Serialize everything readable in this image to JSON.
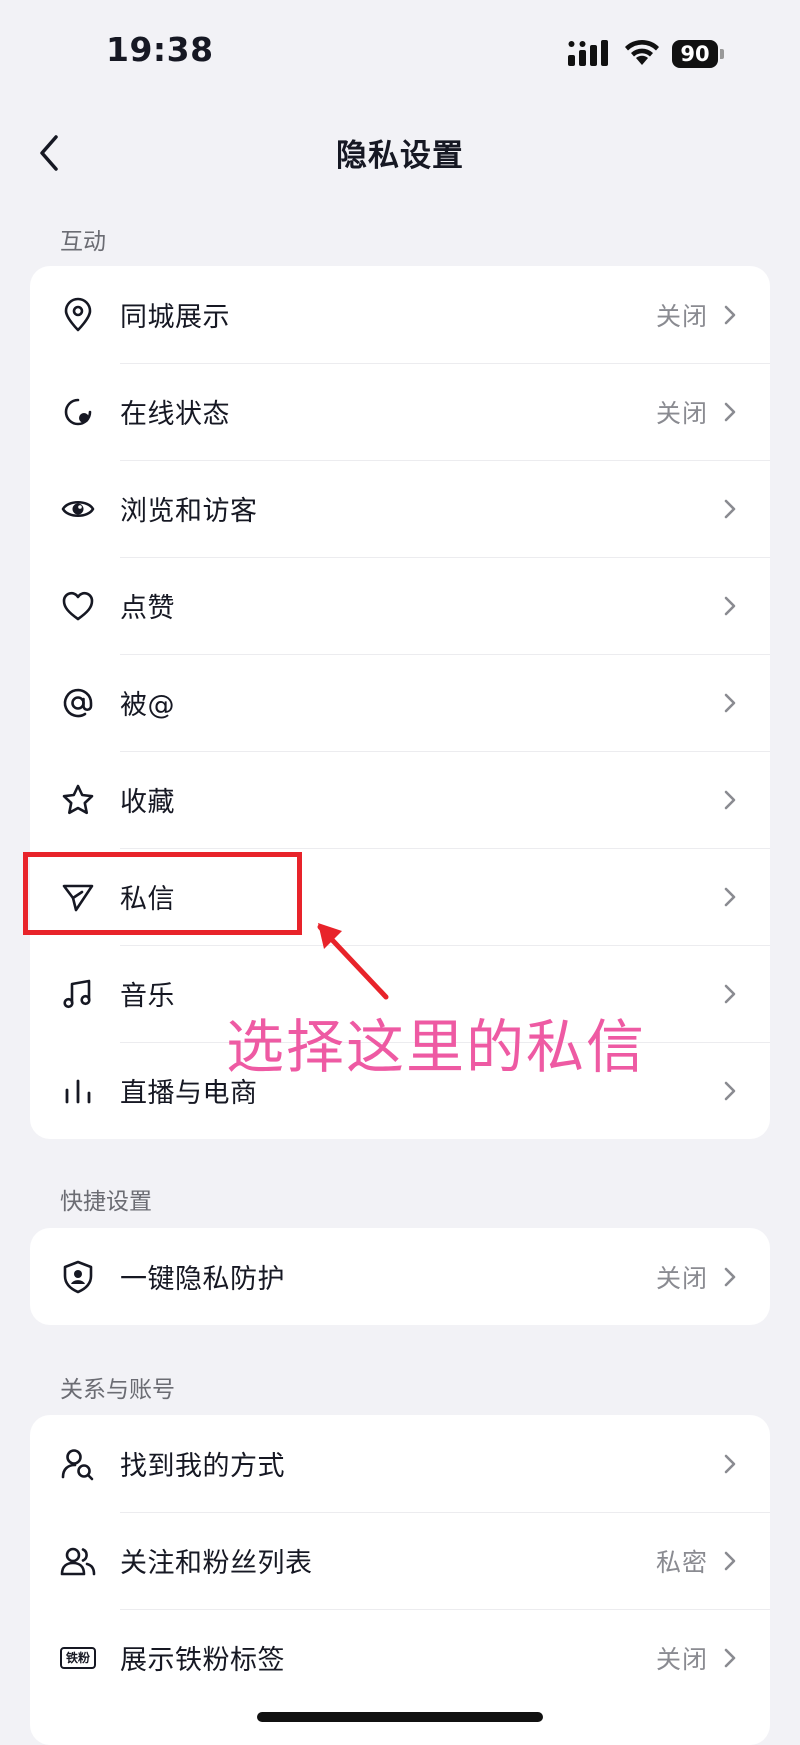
{
  "status_bar": {
    "time": "19:38",
    "battery": "90"
  },
  "nav": {
    "title": "隐私设置"
  },
  "sections": [
    {
      "header": "互动",
      "items": [
        {
          "label": "同城展示",
          "value": "关闭",
          "icon": "location-pin-icon"
        },
        {
          "label": "在线状态",
          "value": "关闭",
          "icon": "online-status-icon"
        },
        {
          "label": "浏览和访客",
          "value": "",
          "icon": "eye-icon"
        },
        {
          "label": "点赞",
          "value": "",
          "icon": "heart-icon"
        },
        {
          "label": "被@",
          "value": "",
          "icon": "at-icon"
        },
        {
          "label": "收藏",
          "value": "",
          "icon": "star-icon"
        },
        {
          "label": "私信",
          "value": "",
          "icon": "paper-plane-icon"
        },
        {
          "label": "音乐",
          "value": "",
          "icon": "music-note-icon"
        },
        {
          "label": "直播与电商",
          "value": "",
          "icon": "bars-icon"
        }
      ]
    },
    {
      "header": "快捷设置",
      "items": [
        {
          "label": "一键隐私防护",
          "value": "关闭",
          "icon": "shield-user-icon"
        }
      ]
    },
    {
      "header": "关系与账号",
      "items": [
        {
          "label": "找到我的方式",
          "value": "",
          "icon": "user-search-icon"
        },
        {
          "label": "关注和粉丝列表",
          "value": "私密",
          "icon": "users-icon"
        },
        {
          "label": "展示铁粉标签",
          "value": "关闭",
          "icon": "fan-badge-icon"
        }
      ]
    }
  ],
  "annotation": {
    "text": "选择这里的私信",
    "highlight_color": "#e8232a",
    "text_color": "#ee5aa3"
  },
  "fan_badge_text": "铁粉"
}
